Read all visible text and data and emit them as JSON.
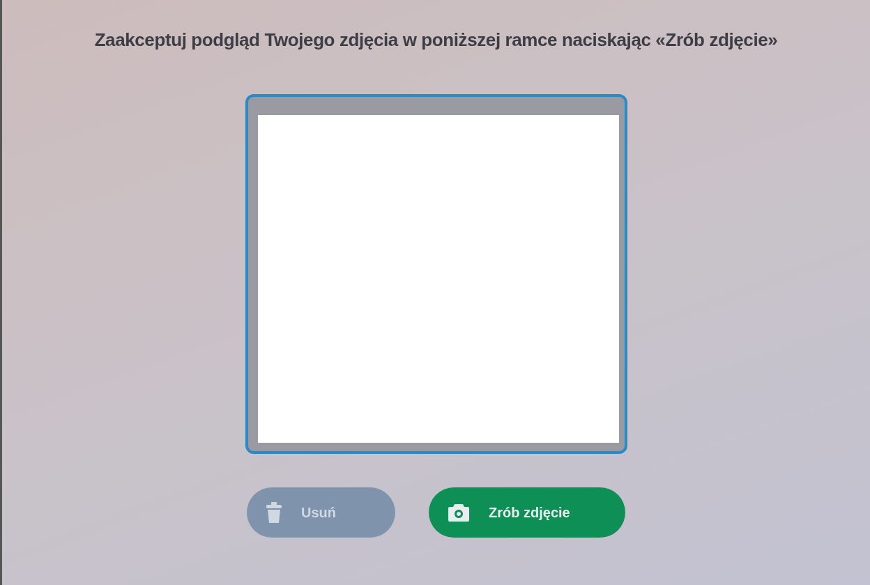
{
  "heading": "Zaakceptuj podgląd Twojego zdjęcia w poniższej ramce naciskając «Zrób zdjęcie»",
  "preview": {
    "empty": true
  },
  "buttons": [
    {
      "label": "Usuń",
      "kind": "delete",
      "disabled": true
    },
    {
      "label": "Zrób zdjęcie",
      "kind": "capture",
      "disabled": false
    }
  ]
}
